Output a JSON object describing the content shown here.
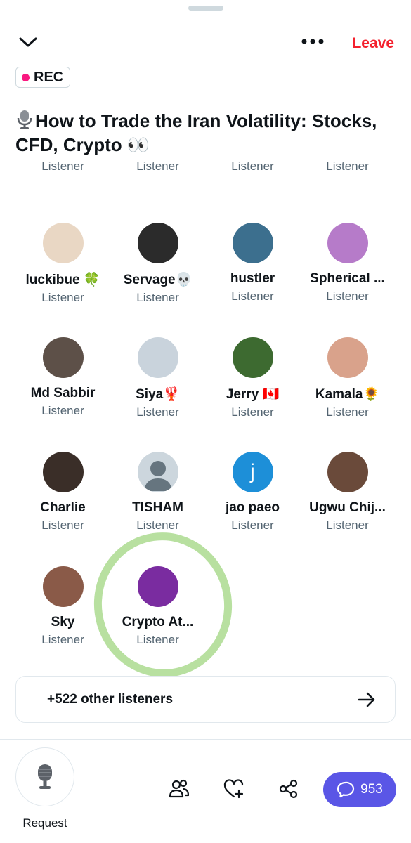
{
  "header": {
    "leave_label": "Leave",
    "rec_label": "REC",
    "title": "How to Trade the Iran Volatility: Stocks, CFD, Crypto 👀"
  },
  "participants": [
    {
      "name": "",
      "role": "Listener",
      "avatar_color": "#cccccc"
    },
    {
      "name": "",
      "role": "Listener",
      "avatar_color": "#cccccc"
    },
    {
      "name": "",
      "role": "Listener",
      "avatar_color": "#cccccc"
    },
    {
      "name": "",
      "role": "Listener",
      "avatar_color": "#cccccc"
    },
    {
      "name": "luckibue 🍀",
      "role": "Listener",
      "avatar_color": "#e9d7c4"
    },
    {
      "name": "Servage💀",
      "role": "Listener",
      "avatar_color": "#2b2b2b"
    },
    {
      "name": "hustler",
      "role": "Listener",
      "avatar_color": "#3c6f8e"
    },
    {
      "name": "Spherical ...",
      "role": "Listener",
      "avatar_color": "#b67bc9"
    },
    {
      "name": "Md Sabbir",
      "role": "Listener",
      "avatar_color": "#5d5048"
    },
    {
      "name": "Siya🦞",
      "role": "Listener",
      "avatar_color": "#c9d3dc"
    },
    {
      "name": "Jerry 🇨🇦",
      "role": "Listener",
      "avatar_color": "#3d6a30"
    },
    {
      "name": "Kamala🌻",
      "role": "Listener",
      "avatar_color": "#d9a28b"
    },
    {
      "name": "Charlie",
      "role": "Listener",
      "avatar_color": "#3a2e28"
    },
    {
      "name": "TISHAM",
      "role": "Listener",
      "avatar_color": "#ccd6dd"
    },
    {
      "name": "jao paeo",
      "role": "Listener",
      "avatar_color": "#1d8fd8",
      "initial": "j"
    },
    {
      "name": "Ugwu Chij...",
      "role": "Listener",
      "avatar_color": "#6a4a3a"
    },
    {
      "name": "Sky",
      "role": "Listener",
      "avatar_color": "#8a5a48"
    },
    {
      "name": "Crypto At...",
      "role": "Listener",
      "avatar_color": "#7a2ca0"
    }
  ],
  "others_label": "+522 other listeners",
  "bottom": {
    "request_label": "Request",
    "chat_count": "953"
  },
  "colors": {
    "leave": "#f4212e",
    "rec_dot": "#f91880",
    "chat_button": "#5a56e6",
    "highlight_circle": "#b8e0a0"
  }
}
